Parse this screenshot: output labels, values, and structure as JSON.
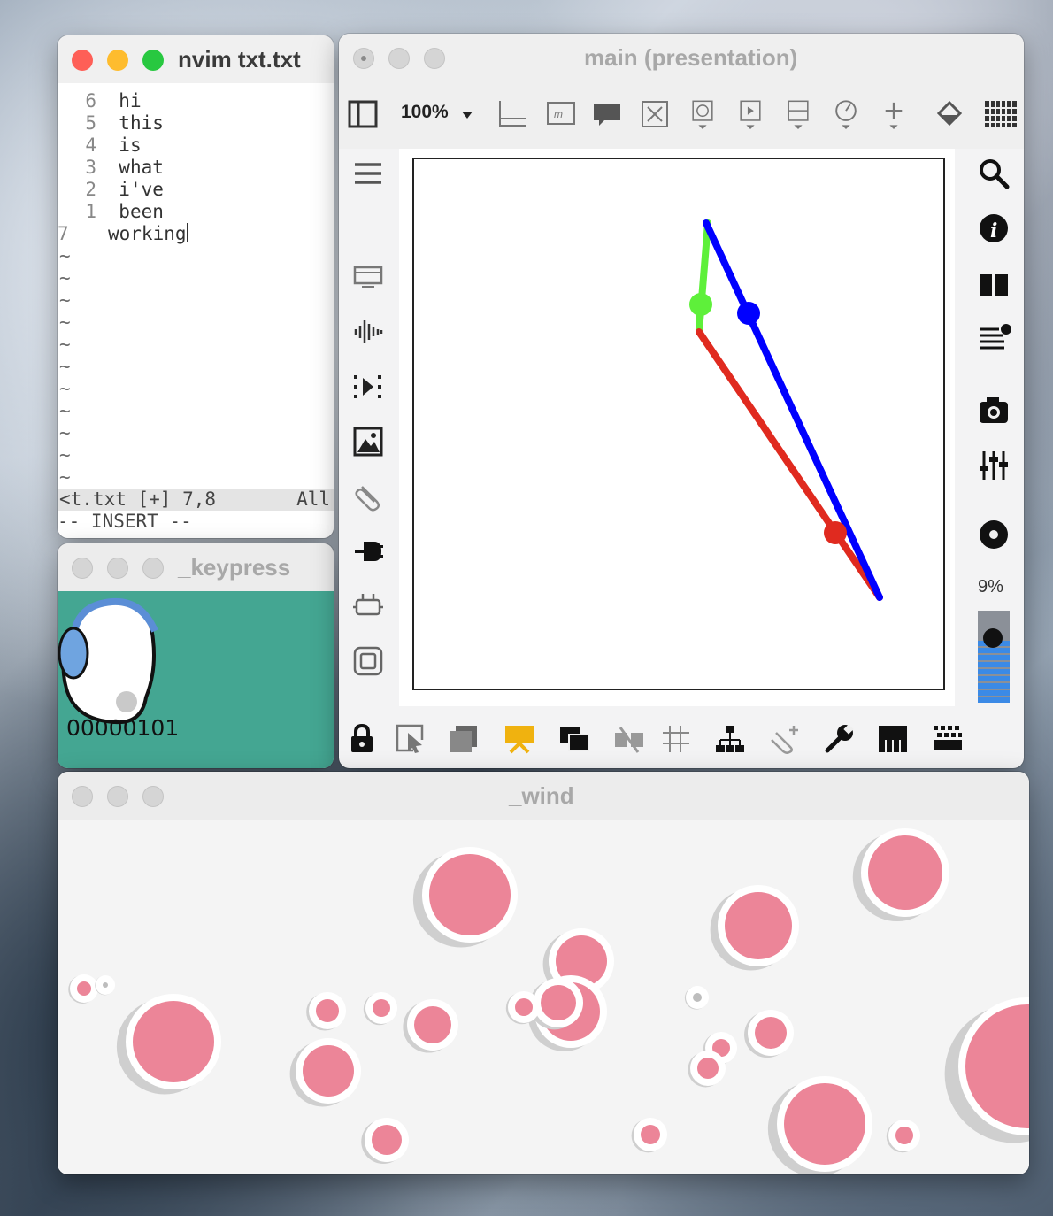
{
  "nvim": {
    "title": "nvim txt.txt",
    "lines": [
      {
        "num": "6",
        "text": "hi"
      },
      {
        "num": "5",
        "text": "this"
      },
      {
        "num": "4",
        "text": "is"
      },
      {
        "num": "3",
        "text": "what"
      },
      {
        "num": "2",
        "text": "i've"
      },
      {
        "num": "1",
        "text": "been"
      }
    ],
    "current_line": {
      "num": "7",
      "text": "working"
    },
    "tilde": "~",
    "status_file": "<t.txt [+] 7,8",
    "status_pos": "All",
    "mode": "-- INSERT --"
  },
  "keypress": {
    "title": "_keypress",
    "code": "00000101",
    "bg_color": "#44a692"
  },
  "main": {
    "title": "main (presentation)",
    "zoom": "100%",
    "volume_pct": "9%",
    "volume_level": 0.09,
    "toolbar_icons": [
      "sidebar-icon",
      "zoom-dropdown",
      "list-layout-icon",
      "message-box-icon",
      "comment-icon",
      "toggle-box-icon",
      "bang-icon",
      "video-icon",
      "slider-icon",
      "dial-icon",
      "add-object-icon",
      "paint-bucket-icon",
      "keyboard-grid-icon"
    ],
    "lines": [
      {
        "color": "#5ef03a",
        "name": "green-line"
      },
      {
        "color": "#0000ff",
        "name": "blue-line"
      },
      {
        "color": "#e02a1f",
        "name": "red-line"
      }
    ]
  },
  "wind": {
    "title": "_wind",
    "bubble_color": "#ec8598"
  }
}
